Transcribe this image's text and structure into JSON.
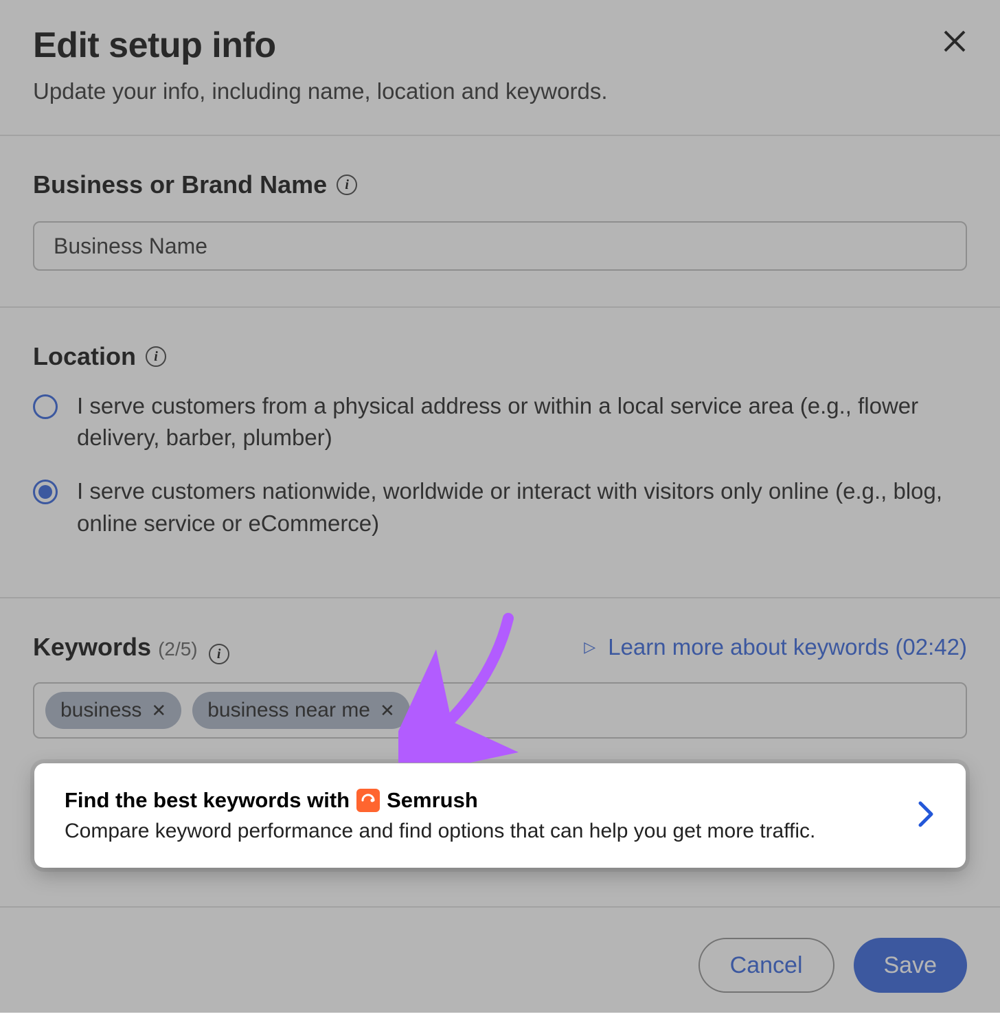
{
  "header": {
    "title": "Edit setup info",
    "subtitle": "Update your info, including name, location and keywords."
  },
  "business": {
    "label": "Business or Brand Name",
    "value": "Business Name"
  },
  "location": {
    "label": "Location",
    "options": [
      "I serve customers from a physical address or within a local service area (e.g., flower delivery, barber, plumber)",
      "I serve customers nationwide, worldwide or interact with visitors only online (e.g., blog, online service or eCommerce)"
    ],
    "selected_index": 1
  },
  "keywords": {
    "label": "Keywords",
    "count_text": "(2/5)",
    "learn_link": "Learn more about keywords (02:42)",
    "tags": [
      "business",
      "business near me"
    ]
  },
  "semrush": {
    "title_prefix": "Find the best keywords with",
    "brand": "Semrush",
    "description": "Compare keyword performance and find options that can help you get more traffic."
  },
  "footer": {
    "cancel": "Cancel",
    "save": "Save"
  }
}
